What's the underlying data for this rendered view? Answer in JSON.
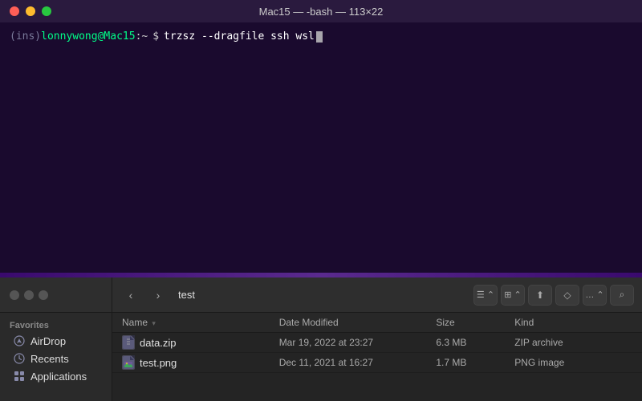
{
  "terminal": {
    "title": "Mac15 — -bash — 113×22",
    "prompt": {
      "ins": "(ins)",
      "user": "lonnywong",
      "at": "@",
      "host": "Mac15",
      "colon": ":",
      "path": "~",
      "dollar": "$",
      "command": "trzsz --dragfile ssh wsl"
    }
  },
  "finder": {
    "toolbar": {
      "path": "test",
      "back_label": "‹",
      "forward_label": "›"
    },
    "sidebar": {
      "traffic_lights": [
        "close",
        "minimize",
        "maximize"
      ],
      "section_favorites": "Favorites",
      "items": [
        {
          "label": "AirDrop",
          "icon": "airdrop"
        },
        {
          "label": "Recents",
          "icon": "clock"
        },
        {
          "label": "Applications",
          "icon": "grid"
        }
      ]
    },
    "file_list": {
      "columns": [
        "Name",
        "Date Modified",
        "Size",
        "Kind"
      ],
      "files": [
        {
          "name": "data.zip",
          "date_modified": "Mar 19, 2022 at 23:27",
          "size": "6.3 MB",
          "kind": "ZIP archive"
        },
        {
          "name": "test.png",
          "date_modified": "Dec 11, 2021 at 16:27",
          "size": "1.7 MB",
          "kind": "PNG image"
        }
      ]
    }
  }
}
